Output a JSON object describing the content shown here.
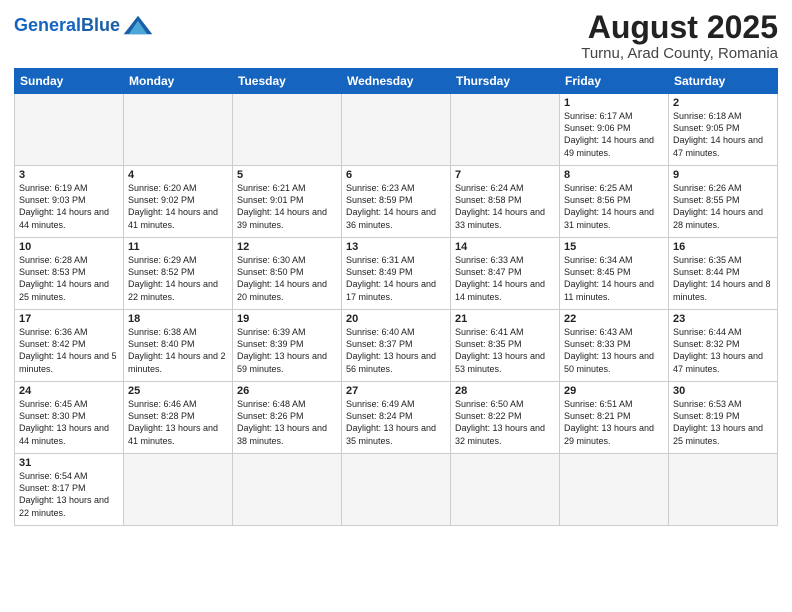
{
  "header": {
    "logo_text_general": "General",
    "logo_text_blue": "Blue",
    "month_title": "August 2025",
    "location": "Turnu, Arad County, Romania"
  },
  "days_of_week": [
    "Sunday",
    "Monday",
    "Tuesday",
    "Wednesday",
    "Thursday",
    "Friday",
    "Saturday"
  ],
  "weeks": [
    [
      {
        "day": "",
        "info": ""
      },
      {
        "day": "",
        "info": ""
      },
      {
        "day": "",
        "info": ""
      },
      {
        "day": "",
        "info": ""
      },
      {
        "day": "",
        "info": ""
      },
      {
        "day": "1",
        "info": "Sunrise: 6:17 AM\nSunset: 9:06 PM\nDaylight: 14 hours and 49 minutes."
      },
      {
        "day": "2",
        "info": "Sunrise: 6:18 AM\nSunset: 9:05 PM\nDaylight: 14 hours and 47 minutes."
      }
    ],
    [
      {
        "day": "3",
        "info": "Sunrise: 6:19 AM\nSunset: 9:03 PM\nDaylight: 14 hours and 44 minutes."
      },
      {
        "day": "4",
        "info": "Sunrise: 6:20 AM\nSunset: 9:02 PM\nDaylight: 14 hours and 41 minutes."
      },
      {
        "day": "5",
        "info": "Sunrise: 6:21 AM\nSunset: 9:01 PM\nDaylight: 14 hours and 39 minutes."
      },
      {
        "day": "6",
        "info": "Sunrise: 6:23 AM\nSunset: 8:59 PM\nDaylight: 14 hours and 36 minutes."
      },
      {
        "day": "7",
        "info": "Sunrise: 6:24 AM\nSunset: 8:58 PM\nDaylight: 14 hours and 33 minutes."
      },
      {
        "day": "8",
        "info": "Sunrise: 6:25 AM\nSunset: 8:56 PM\nDaylight: 14 hours and 31 minutes."
      },
      {
        "day": "9",
        "info": "Sunrise: 6:26 AM\nSunset: 8:55 PM\nDaylight: 14 hours and 28 minutes."
      }
    ],
    [
      {
        "day": "10",
        "info": "Sunrise: 6:28 AM\nSunset: 8:53 PM\nDaylight: 14 hours and 25 minutes."
      },
      {
        "day": "11",
        "info": "Sunrise: 6:29 AM\nSunset: 8:52 PM\nDaylight: 14 hours and 22 minutes."
      },
      {
        "day": "12",
        "info": "Sunrise: 6:30 AM\nSunset: 8:50 PM\nDaylight: 14 hours and 20 minutes."
      },
      {
        "day": "13",
        "info": "Sunrise: 6:31 AM\nSunset: 8:49 PM\nDaylight: 14 hours and 17 minutes."
      },
      {
        "day": "14",
        "info": "Sunrise: 6:33 AM\nSunset: 8:47 PM\nDaylight: 14 hours and 14 minutes."
      },
      {
        "day": "15",
        "info": "Sunrise: 6:34 AM\nSunset: 8:45 PM\nDaylight: 14 hours and 11 minutes."
      },
      {
        "day": "16",
        "info": "Sunrise: 6:35 AM\nSunset: 8:44 PM\nDaylight: 14 hours and 8 minutes."
      }
    ],
    [
      {
        "day": "17",
        "info": "Sunrise: 6:36 AM\nSunset: 8:42 PM\nDaylight: 14 hours and 5 minutes."
      },
      {
        "day": "18",
        "info": "Sunrise: 6:38 AM\nSunset: 8:40 PM\nDaylight: 14 hours and 2 minutes."
      },
      {
        "day": "19",
        "info": "Sunrise: 6:39 AM\nSunset: 8:39 PM\nDaylight: 13 hours and 59 minutes."
      },
      {
        "day": "20",
        "info": "Sunrise: 6:40 AM\nSunset: 8:37 PM\nDaylight: 13 hours and 56 minutes."
      },
      {
        "day": "21",
        "info": "Sunrise: 6:41 AM\nSunset: 8:35 PM\nDaylight: 13 hours and 53 minutes."
      },
      {
        "day": "22",
        "info": "Sunrise: 6:43 AM\nSunset: 8:33 PM\nDaylight: 13 hours and 50 minutes."
      },
      {
        "day": "23",
        "info": "Sunrise: 6:44 AM\nSunset: 8:32 PM\nDaylight: 13 hours and 47 minutes."
      }
    ],
    [
      {
        "day": "24",
        "info": "Sunrise: 6:45 AM\nSunset: 8:30 PM\nDaylight: 13 hours and 44 minutes."
      },
      {
        "day": "25",
        "info": "Sunrise: 6:46 AM\nSunset: 8:28 PM\nDaylight: 13 hours and 41 minutes."
      },
      {
        "day": "26",
        "info": "Sunrise: 6:48 AM\nSunset: 8:26 PM\nDaylight: 13 hours and 38 minutes."
      },
      {
        "day": "27",
        "info": "Sunrise: 6:49 AM\nSunset: 8:24 PM\nDaylight: 13 hours and 35 minutes."
      },
      {
        "day": "28",
        "info": "Sunrise: 6:50 AM\nSunset: 8:22 PM\nDaylight: 13 hours and 32 minutes."
      },
      {
        "day": "29",
        "info": "Sunrise: 6:51 AM\nSunset: 8:21 PM\nDaylight: 13 hours and 29 minutes."
      },
      {
        "day": "30",
        "info": "Sunrise: 6:53 AM\nSunset: 8:19 PM\nDaylight: 13 hours and 25 minutes."
      }
    ],
    [
      {
        "day": "31",
        "info": "Sunrise: 6:54 AM\nSunset: 8:17 PM\nDaylight: 13 hours and 22 minutes."
      },
      {
        "day": "",
        "info": ""
      },
      {
        "day": "",
        "info": ""
      },
      {
        "day": "",
        "info": ""
      },
      {
        "day": "",
        "info": ""
      },
      {
        "day": "",
        "info": ""
      },
      {
        "day": "",
        "info": ""
      }
    ]
  ]
}
